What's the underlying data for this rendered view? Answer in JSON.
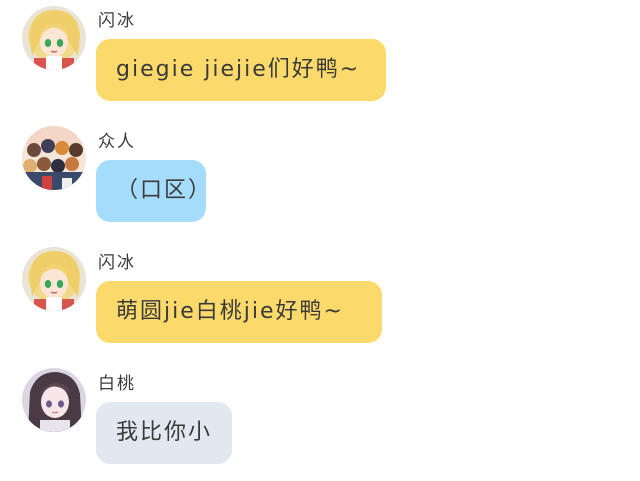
{
  "colors": {
    "yellow_bubble": "#fbd96a",
    "blue_bubble": "#a5dcfb",
    "gray_bubble": "#e2e8ef",
    "text": "#3a3a3a"
  },
  "messages": [
    {
      "sender": "闪冰",
      "text": "giegie jiejie们好鸭~",
      "avatar": "blonde-girl-avatar",
      "bubble_color": "yellow"
    },
    {
      "sender": "众人",
      "text": "（口区）",
      "avatar": "group-avatar",
      "bubble_color": "blue"
    },
    {
      "sender": "闪冰",
      "text": "萌圆jie白桃jie好鸭~",
      "avatar": "blonde-girl-avatar",
      "bubble_color": "yellow"
    },
    {
      "sender": "白桃",
      "text": "我比你小",
      "avatar": "dark-hair-girl-avatar",
      "bubble_color": "gray"
    }
  ]
}
